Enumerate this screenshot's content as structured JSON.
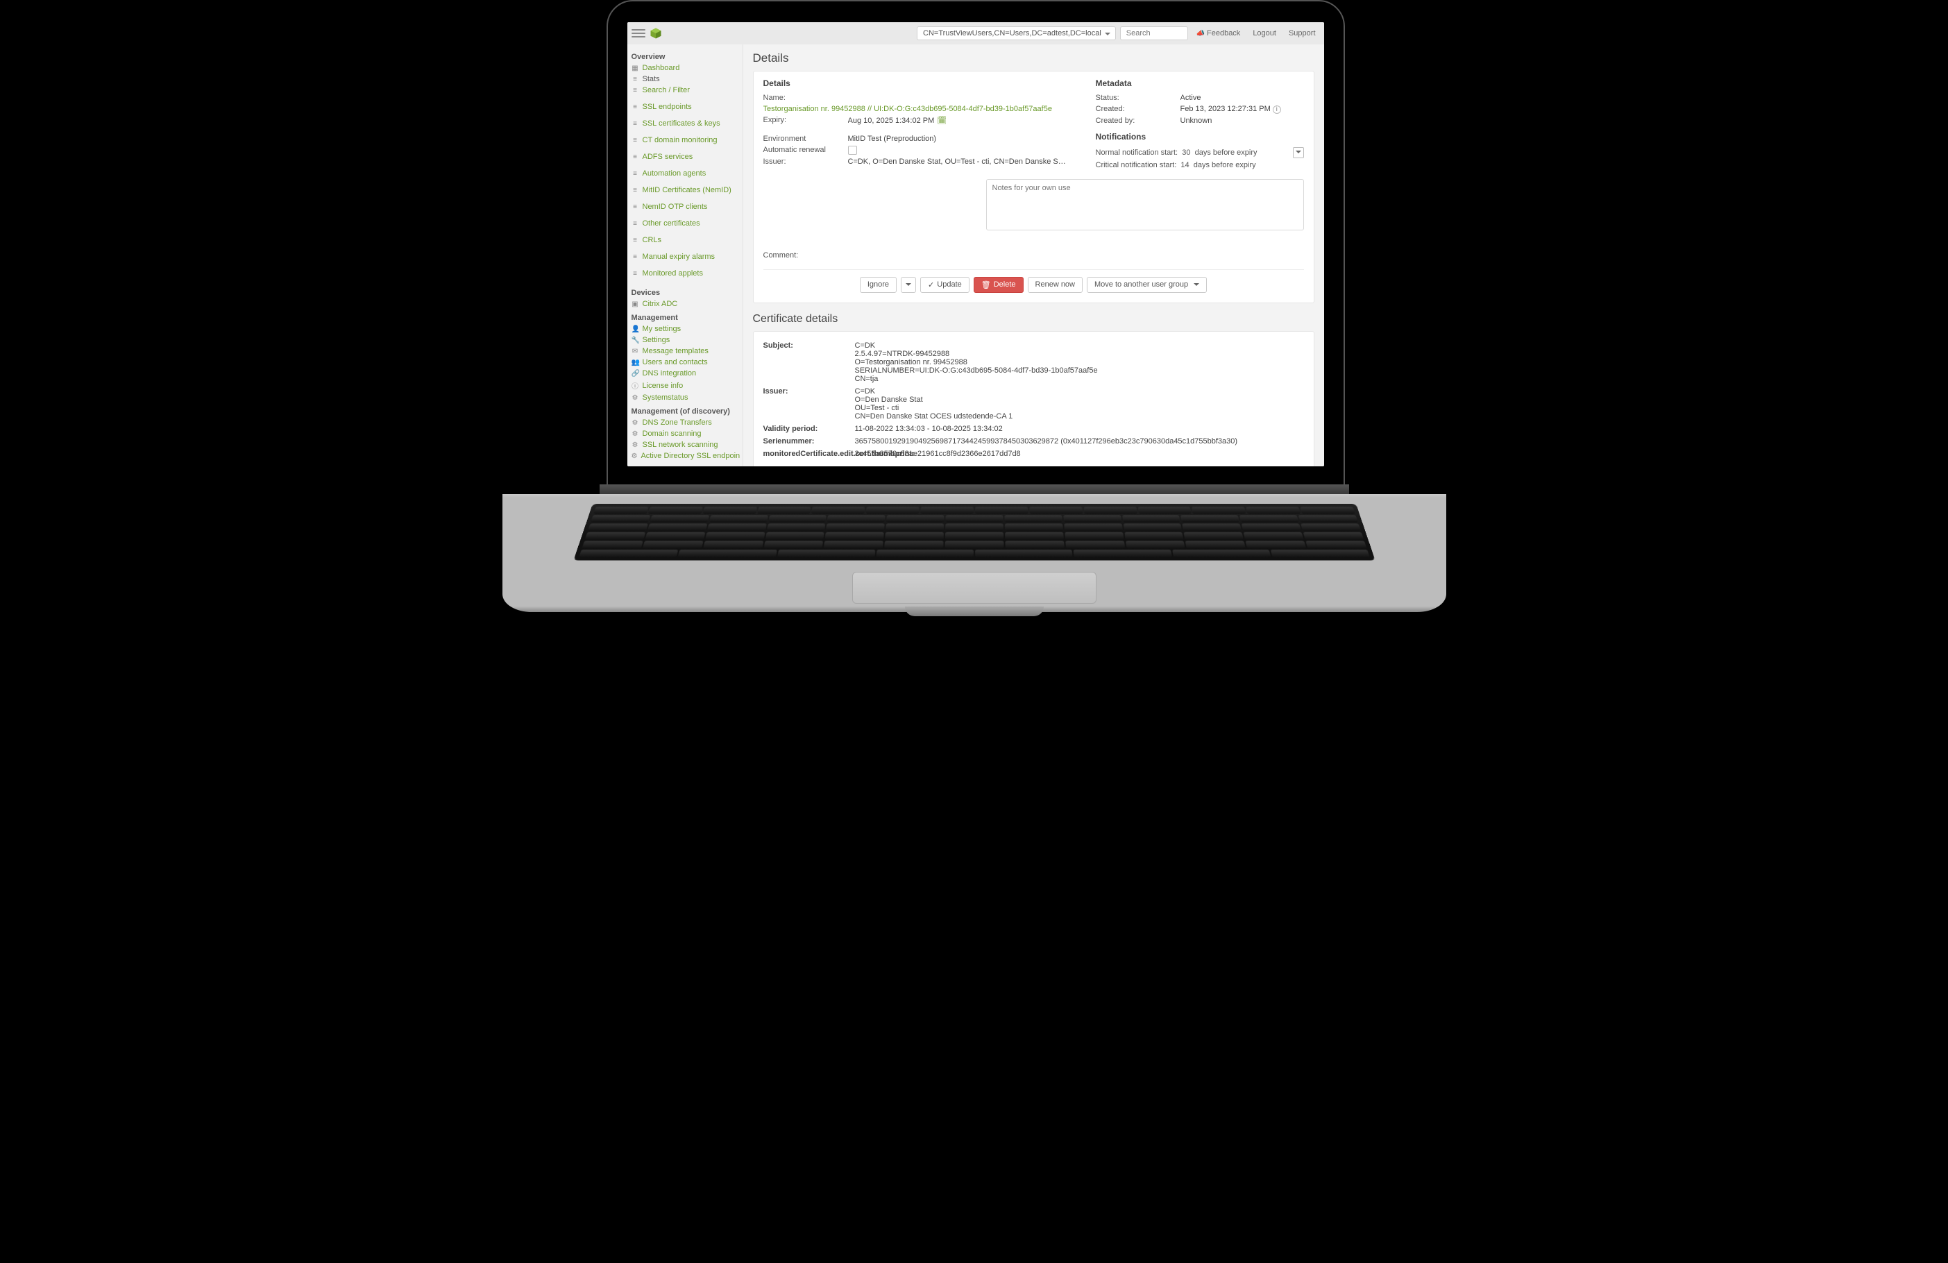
{
  "topbar": {
    "usergroup_selected": "CN=TrustViewUsers,CN=Users,DC=adtest,DC=local",
    "search_placeholder": "Search",
    "feedback": "Feedback",
    "logout": "Logout",
    "support": "Support"
  },
  "sidebar": {
    "overview_head": "Overview",
    "overview": [
      {
        "icon": "▦",
        "label": "Dashboard"
      },
      {
        "icon": "≡",
        "label": "Stats",
        "dark": true
      },
      {
        "icon": "≡",
        "label": "Search / Filter"
      }
    ],
    "cert_items": [
      {
        "icon": "≡",
        "label": "SSL endpoints"
      },
      {
        "icon": "≡",
        "label": "SSL certificates & keys"
      },
      {
        "icon": "≡",
        "label": "CT domain monitoring"
      },
      {
        "icon": "≡",
        "label": "ADFS services"
      },
      {
        "icon": "≡",
        "label": "Automation agents"
      },
      {
        "icon": "≡",
        "label": "MitID Certificates (NemID)"
      },
      {
        "icon": "≡",
        "label": "NemID OTP clients"
      },
      {
        "icon": "≡",
        "label": "Other certificates"
      },
      {
        "icon": "≡",
        "label": "CRLs"
      },
      {
        "icon": "≡",
        "label": "Manual expiry alarms"
      },
      {
        "icon": "≡",
        "label": "Monitored applets"
      }
    ],
    "devices_head": "Devices",
    "devices": [
      {
        "icon": "▣",
        "label": "Citrix ADC"
      }
    ],
    "management_head": "Management",
    "management": [
      {
        "icon": "👤",
        "label": "My settings"
      },
      {
        "icon": "🔧",
        "label": "Settings"
      },
      {
        "icon": "✉",
        "label": "Message templates"
      },
      {
        "icon": "👥",
        "label": "Users and contacts"
      },
      {
        "icon": "🔗",
        "label": "DNS integration"
      },
      {
        "icon": "ⓘ",
        "label": "License info"
      },
      {
        "icon": "⚙",
        "label": "Systemstatus"
      }
    ],
    "discovery_head": "Management (of discovery)",
    "discovery": [
      {
        "icon": "⚙",
        "label": "DNS Zone Transfers"
      },
      {
        "icon": "⚙",
        "label": "Domain scanning"
      },
      {
        "icon": "⚙",
        "label": "SSL network scanning"
      },
      {
        "icon": "⚙",
        "label": "Active Directory SSL endpoint discovery"
      }
    ]
  },
  "details": {
    "page_title": "Details",
    "details_head": "Details",
    "name_label": "Name:",
    "name_value": "Testorganisation nr. 99452988 // UI:DK-O:G:c43db695-5084-4df7-bd39-1b0af57aaf5e",
    "expiry_label": "Expiry:",
    "expiry_value": "Aug 10, 2025 1:34:02 PM",
    "env_label": "Environment",
    "env_value": "MitID Test (Preproduction)",
    "autorenew_label": "Automatic renewal",
    "issuer_label": "Issuer:",
    "issuer_value": "C=DK, O=Den Danske Stat, OU=Test - cti, CN=Den Danske Stat OCES udsteden…",
    "comment_label": "Comment:",
    "notes_placeholder": "Notes for your own use",
    "metadata_head": "Metadata",
    "status_label": "Status:",
    "status_value": "Active",
    "created_label": "Created:",
    "created_value": "Feb 13, 2023 12:27:31 PM",
    "createdby_label": "Created by:",
    "createdby_value": "Unknown",
    "notifications_head": "Notifications",
    "notif_normal_prefix": "Normal notification start:",
    "notif_normal_days": "30",
    "notif_crit_prefix": "Critical notification start:",
    "notif_crit_days": "14",
    "notif_suffix": "days before expiry",
    "buttons": {
      "ignore": "Ignore",
      "update": "Update",
      "delete": "Delete",
      "renew": "Renew now",
      "move": "Move to another user group"
    }
  },
  "certdetails": {
    "title": "Certificate details",
    "subject_label": "Subject:",
    "subject_value": "C=DK\n2.5.4.97=NTRDK-99452988\nO=Testorganisation nr. 99452988\nSERIALNUMBER=UI:DK-O:G:c43db695-5084-4df7-bd39-1b0af57aaf5e\nCN=tja",
    "issuer_label": "Issuer:",
    "issuer_value": "C=DK\nO=Den Danske Stat\nOU=Test - cti\nCN=Den Danske Stat OCES udstedende-CA 1",
    "validity_label": "Validity period:",
    "validity_value": "11-08-2022 13:34:03 - 10-08-2025 13:34:02",
    "serial_label": "Serienummer:",
    "serial_value": "365758001929190492569871734424599378450303629872 (0x401127f296eb3c23c790630da45c1d755bbf3a30)",
    "thumb_label": "monitoredCertificate.edit.cert.thumbprint:",
    "thumb_value": "3c455a8570c88ae21961cc8f9d2366e2617dd7d8"
  }
}
